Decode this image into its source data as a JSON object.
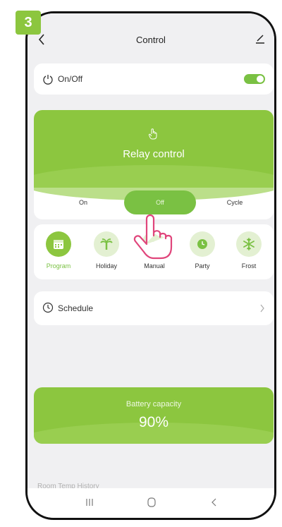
{
  "step_badge": "3",
  "header": {
    "title": "Control"
  },
  "power": {
    "label": "On/Off",
    "toggle_on": true
  },
  "relay": {
    "title": "Relay control",
    "options": [
      {
        "label": "On"
      },
      {
        "label": "Off",
        "selected": true
      },
      {
        "label": "Cycle"
      }
    ]
  },
  "modes": [
    {
      "label": "Program",
      "icon": "calendar-icon",
      "active": true
    },
    {
      "label": "Holiday",
      "icon": "palm-tree-icon"
    },
    {
      "label": "Manual",
      "icon": "hand-icon"
    },
    {
      "label": "Party",
      "icon": "clock-icon"
    },
    {
      "label": "Frost",
      "icon": "snowflake-icon"
    }
  ],
  "schedule": {
    "label": "Schedule"
  },
  "battery": {
    "label": "Battery capacity",
    "value": "90%"
  },
  "history": {
    "label": "Room Temp History"
  },
  "colors": {
    "accent": "#8cc63f",
    "accent_dark": "#7ac143",
    "background": "#f0f0f2",
    "hand_outline": "#e0457b"
  }
}
